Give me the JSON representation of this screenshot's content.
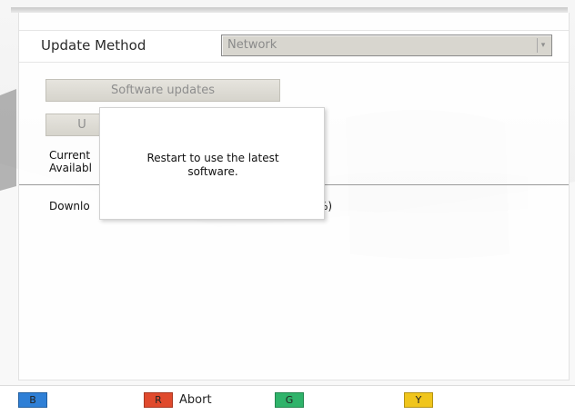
{
  "settings": {
    "update_method_label": "Update Method",
    "update_method_value": "Network",
    "software_updates_button": "Software updates",
    "second_button_partial": "U",
    "current_label_partial": "Current",
    "available_label_partial": "Availabl",
    "download_label_partial": "Downlo",
    "download_suffix_partial": "%)"
  },
  "dialog": {
    "message_line1": "Restart to use the latest",
    "message_line2": "software."
  },
  "color_keys": {
    "blue": {
      "key": "B",
      "color": "#2e7fd6",
      "action": ""
    },
    "red": {
      "key": "R",
      "color": "#e04a2d",
      "action": "Abort"
    },
    "green": {
      "key": "G",
      "color": "#2fb36a",
      "action": ""
    },
    "yellow": {
      "key": "Y",
      "color": "#f0c51c",
      "action": ""
    }
  },
  "icons": {
    "select_arrow": "chevron-down-icon"
  }
}
